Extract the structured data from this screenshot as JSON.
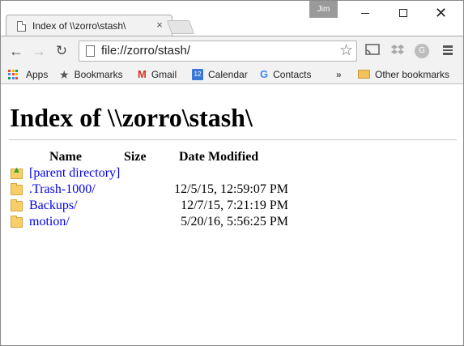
{
  "window": {
    "profile_name": "Jim",
    "controls": {
      "minimize": "minimize-icon",
      "maximize": "maximize-icon",
      "close": "close-icon"
    }
  },
  "tabs": [
    {
      "title": "Index of \\\\zorro\\stash\\",
      "icon": "page-icon",
      "close_icon": "close-icon"
    }
  ],
  "toolbar": {
    "back_icon": "arrow-left-icon",
    "forward_icon": "arrow-right-icon",
    "reload_icon": "reload-icon",
    "url": "file://zorro/stash/",
    "star_icon": "star-icon",
    "extensions": [
      "cast-icon",
      "dropbox-icon",
      "g-extension-icon"
    ],
    "menu_icon": "menu-icon"
  },
  "bookmarks_bar": {
    "items": [
      {
        "label": "Apps",
        "icon": "apps-grid-icon"
      },
      {
        "label": "Bookmarks",
        "icon": "star-icon"
      },
      {
        "label": "Gmail",
        "icon": "gmail-icon"
      },
      {
        "label": "Calendar",
        "icon": "calendar-icon",
        "icon_text": "12"
      },
      {
        "label": "Contacts",
        "icon": "google-icon"
      }
    ],
    "overflow": "»",
    "other": {
      "label": "Other bookmarks",
      "icon": "folder-icon"
    }
  },
  "page": {
    "heading": "Index of \\\\zorro\\stash\\",
    "columns": [
      "Name",
      "Size",
      "Date Modified"
    ],
    "rows": [
      {
        "name": "[parent directory]",
        "size": "",
        "date": "",
        "icon": "parent-directory-icon"
      },
      {
        "name": ".Trash-1000/",
        "size": "",
        "date": "12/5/15, 12:59:07 PM",
        "icon": "folder-icon"
      },
      {
        "name": "Backups/",
        "size": "",
        "date": "12/7/15, 7:21:19 PM",
        "icon": "folder-icon"
      },
      {
        "name": "motion/",
        "size": "",
        "date": "5/20/16, 5:56:25 PM",
        "icon": "folder-icon"
      }
    ],
    "link_color": "#0000ee"
  }
}
